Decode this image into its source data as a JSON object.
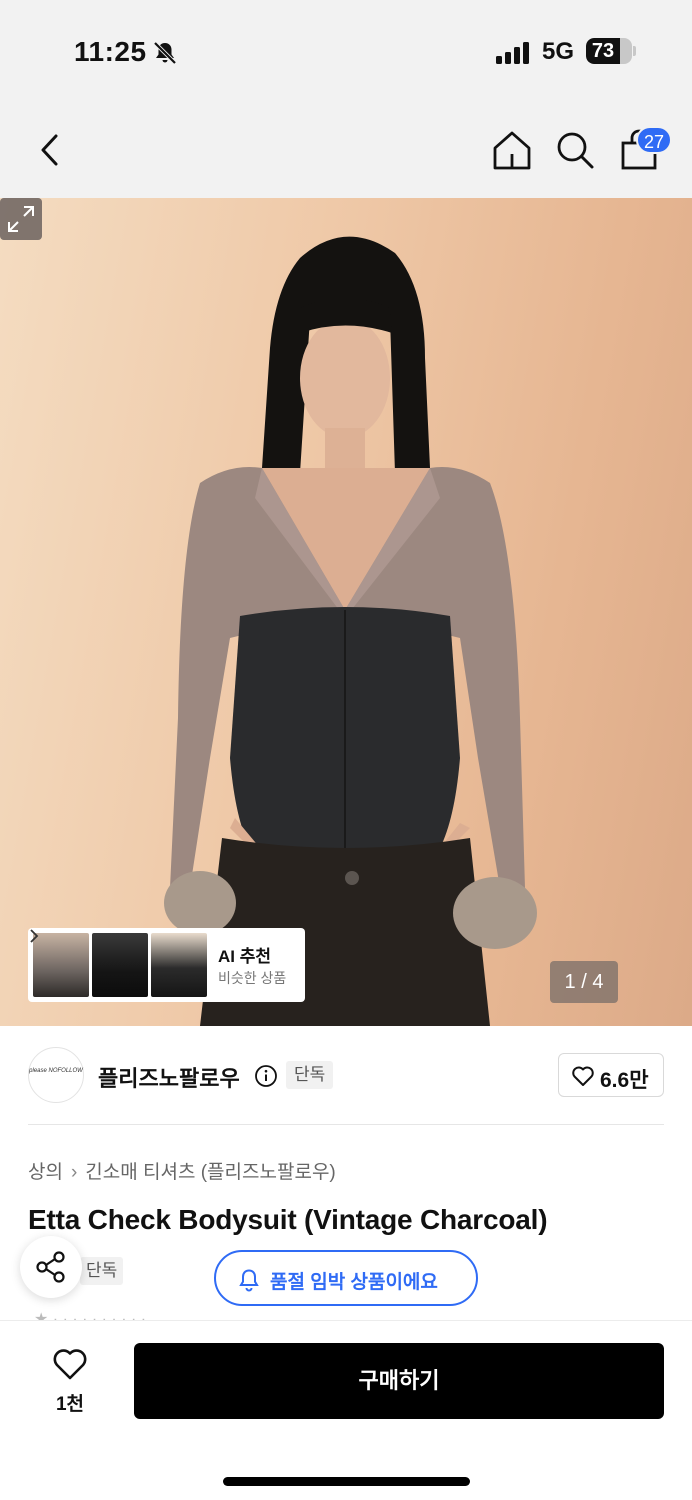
{
  "status_bar": {
    "time": "11:25",
    "network": "5G",
    "battery": "73",
    "battery_level": 0.73,
    "icons": [
      "bell-off-icon",
      "signal-icon",
      "battery-icon"
    ]
  },
  "nav": {
    "icons": [
      "chevron-left-icon",
      "home-icon",
      "search-icon",
      "shopping-bag-icon"
    ],
    "cart_count": "27"
  },
  "gallery": {
    "ai_title": "AI 추천",
    "ai_subtitle": "비슷한 상품",
    "page_indicator": "1 / 4",
    "icons": [
      "chevron-right-icon",
      "expand-icon"
    ]
  },
  "brand": {
    "logo_text": "please NOFOLLOW",
    "name": "플리즈노팔로우",
    "tag": "단독",
    "likes": "6.6만",
    "icons": [
      "info-icon",
      "heart-outline-icon"
    ]
  },
  "product": {
    "breadcrumb": [
      "상의",
      "긴소매 티셔츠 (플리즈노팔로우)"
    ],
    "title": "Etta Check Bodysuit (Vintage Charcoal)",
    "tag": "단독",
    "stock_alert": "품절 임박 상품이에요",
    "icons": [
      "share-icon",
      "bell-icon"
    ]
  },
  "bottom_bar": {
    "wish_count": "1천",
    "buy_label": "구매하기",
    "icons": [
      "heart-outline-icon"
    ]
  }
}
